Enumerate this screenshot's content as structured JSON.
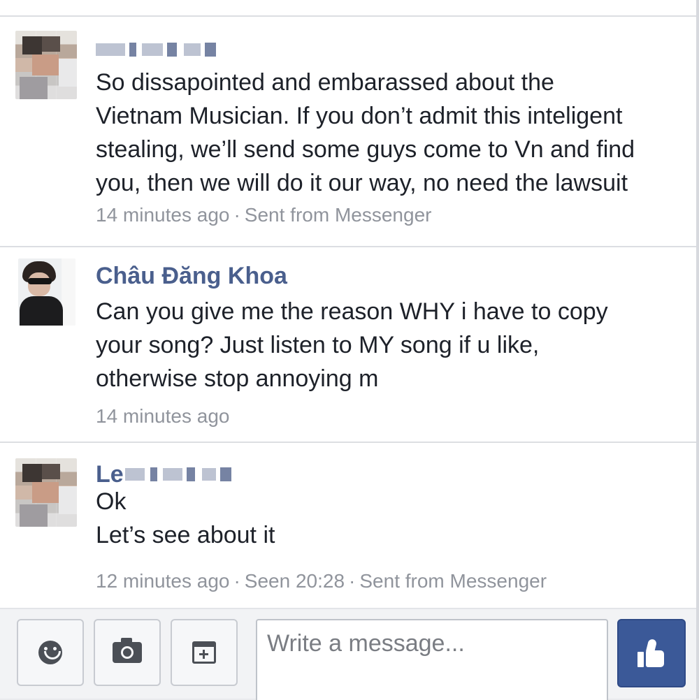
{
  "thread": {
    "messages": [
      {
        "sender_visible": "",
        "lines": [
          "So dissapointed and embarassed about the",
          "Vietnam Musician. If you don’t admit this inteligent",
          "stealing, we’ll send some guys come to Vn and find",
          "you, then we will do it our way, no need the lawsuit"
        ],
        "time": "14 minutes ago",
        "separator": "·",
        "via": "Sent from Messenger"
      },
      {
        "sender": "Châu Đăng Khoa",
        "lines": [
          "Can you give me the reason WHY i have to copy",
          "your song? Just listen to MY song if u like,",
          "otherwise stop annoying m"
        ],
        "time": "14 minutes ago"
      },
      {
        "sender_visible": "Le",
        "lines": [
          "Ok",
          "Let’s see about it"
        ],
        "time": "12 minutes ago",
        "separator": "·",
        "seen": "Seen 20:28",
        "via": "Sent from Messenger"
      }
    ]
  },
  "composer": {
    "placeholder": "Write a message...",
    "icons": {
      "emoji": "emoji-icon",
      "camera": "camera-icon",
      "sticker": "sticker-icon",
      "like": "thumbs-up-icon"
    },
    "like_color": "#3b5998"
  },
  "colors": {
    "name": "#4a5f8d",
    "meta": "#90949c",
    "text": "#1d2129"
  }
}
